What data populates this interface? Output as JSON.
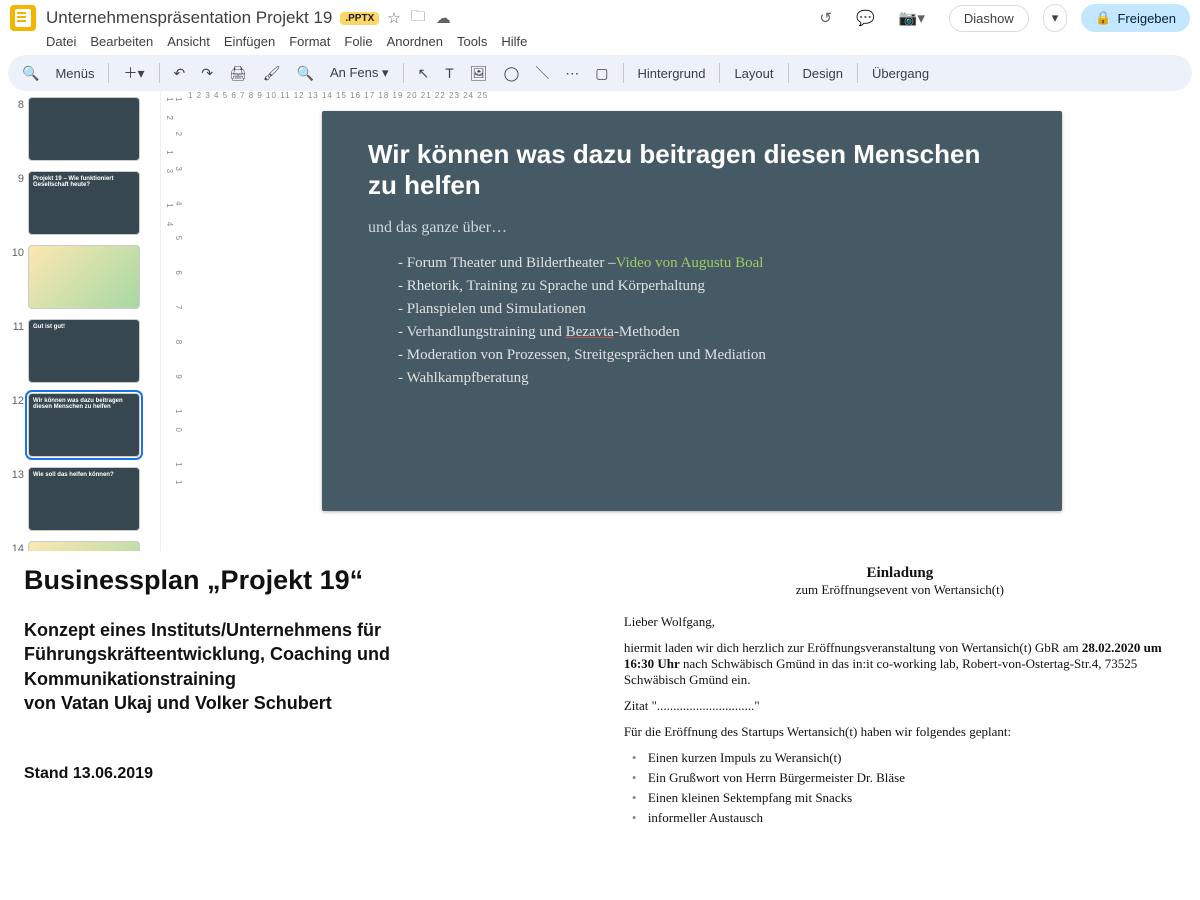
{
  "header": {
    "doc_title": "Unternehmenspräsentation Projekt 19",
    "badge": ".PPTX",
    "star_icon": "☆",
    "move_icon": "🗀",
    "cloud_icon": "☁",
    "history_icon": "↺",
    "comment_icon": "💬",
    "camera_icon": "📷▾",
    "slideshow_label": "Diashow",
    "slideshow_caret": "▾",
    "share_icon": "🔒",
    "share_label": "Freigeben"
  },
  "menubar": [
    "Datei",
    "Bearbeiten",
    "Ansicht",
    "Einfügen",
    "Format",
    "Folie",
    "Anordnen",
    "Tools",
    "Hilfe"
  ],
  "toolbar": {
    "search_icon": "🔍",
    "menus": "Menüs",
    "plus": "＋▾",
    "undo": "↶",
    "redo": "↷",
    "print": "🖨",
    "paint": "🖌",
    "zoom_icon": "🔍",
    "zoom": "An Fens ▾",
    "pointer": "↖",
    "text": "T",
    "image": "🖼",
    "shape": "◯",
    "line": "＼",
    "more": "⋯",
    "present": "▢",
    "bg": "Hintergrund",
    "layout": "Layout",
    "design": "Design",
    "transition": "Übergang"
  },
  "ruler": "  1    2    3    4    5    6    7    8    9    10    11    12    13    14    15    16    17    18    19    20    21    22    23    24    25",
  "thumbs": [
    {
      "num": "8",
      "title": "",
      "selected": false,
      "light": false
    },
    {
      "num": "9",
      "title": "Projekt 19 – Wie funktioniert Gesellschaft heute?",
      "selected": false,
      "light": false
    },
    {
      "num": "10",
      "title": "",
      "selected": false,
      "light": true
    },
    {
      "num": "11",
      "title": "Gut ist gut!",
      "selected": false,
      "light": false
    },
    {
      "num": "12",
      "title": "Wir können was dazu beitragen diesen Menschen zu helfen",
      "selected": true,
      "light": false
    },
    {
      "num": "13",
      "title": "Wie soll das helfen können?",
      "selected": false,
      "light": false
    },
    {
      "num": "14",
      "title": "",
      "selected": false,
      "light": true
    }
  ],
  "slide": {
    "title": "Wir können was dazu beitragen diesen Menschen zu helfen",
    "subtitle": "und das ganze über…",
    "items": [
      {
        "pre": "Forum Theater und Bildertheater –",
        "link": "Video von Augustu Boal"
      },
      {
        "pre": "Rhetorik, Training zu Sprache und Körperhaltung"
      },
      {
        "pre": "Planspielen und Simulationen"
      },
      {
        "pre": "Verhandlungstraining und ",
        "ul": "Bezavta",
        "post": "-Methoden"
      },
      {
        "pre": "Moderation von Prozessen, Streitgesprächen und Mediation"
      },
      {
        "pre": "Wahlkampfberatung"
      }
    ]
  },
  "businessplan": {
    "title": "Businessplan „Projekt 19“",
    "line1": "Konzept eines Instituts/Unternehmens für",
    "line2": "Führungskräfteentwicklung, Coaching und",
    "line3": "Kommunikationstraining",
    "line4": "von Vatan Ukaj und Volker Schubert",
    "stand": "Stand 13.06.2019"
  },
  "invitation": {
    "title": "Einladung",
    "subtitle": "zum Eröffnungsevent von Wertansich(t)",
    "salutation": "Lieber Wolfgang,",
    "body1a": "hiermit laden wir dich herzlich zur Eröffnungsveranstaltung von Wertansich(t) GbR am ",
    "date": "28.02.2020 um 16:30 Uhr",
    "body1b": " nach Schwäbisch Gmünd in das in:it co-working lab, Robert-von-Ostertag-Str.4, 73525 Schwäbisch Gmünd ein.",
    "zitat": "Zitat \"..............................\"",
    "body2": "Für die Eröffnung des Startups Wertansich(t) haben wir folgendes geplant:",
    "bullets": [
      "Einen kurzen Impuls zu Weransich(t)",
      "Ein Grußwort von Herrn Bürgermeister Dr. Bläse",
      "Einen kleinen Sektempfang mit Snacks",
      "informeller Austausch"
    ]
  }
}
